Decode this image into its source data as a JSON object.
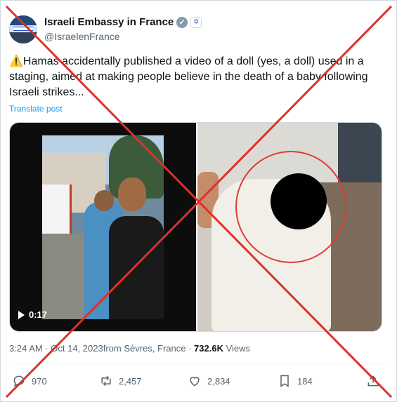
{
  "author": {
    "name": "Israeli Embassy in France",
    "handle": "@IsraelenFrance",
    "verified_icon": "verified-badge-icon",
    "affiliate_icon": "flag-affiliate-icon"
  },
  "tweet": {
    "warning_emoji": "⚠️",
    "text": "Hamas accidentally published a video of a doll (yes, a doll) used in a staging, aimed at making people believe in the death of a baby following Israeli strikes...",
    "translate_label": "Translate post"
  },
  "media": {
    "video_duration": "0:17"
  },
  "meta": {
    "time": "3:24 AM",
    "separator1": " · ",
    "date": "Oct 14, 2023",
    "location": "from Sèvres, France",
    "separator2": " · ",
    "views_count": "732.6K",
    "views_label": " Views"
  },
  "actions": {
    "replies": "970",
    "reposts": "2,457",
    "likes": "2,834",
    "bookmarks": "184"
  },
  "colors": {
    "cross": "#d9322a",
    "link": "#1d9bf0",
    "secondary_text": "#536471"
  }
}
